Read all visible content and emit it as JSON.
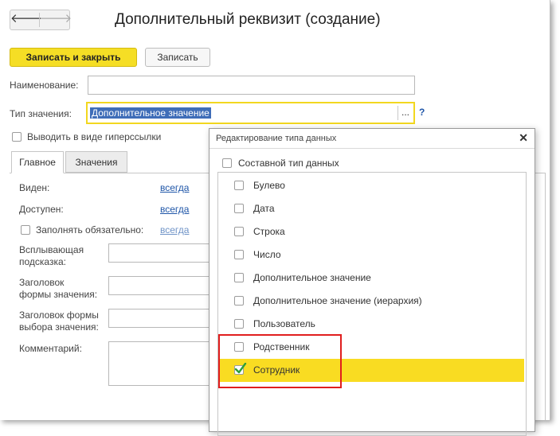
{
  "window": {
    "title": "Дополнительный реквизит (создание)"
  },
  "nav": {
    "back_glyph": "🡐",
    "forward_glyph": "🡒"
  },
  "toolbar": {
    "save_close_label": "Записать и закрыть",
    "save_label": "Записать"
  },
  "form": {
    "name_label": "Наименование:",
    "name_value": "",
    "type_label": "Тип значения:",
    "type_value": "Дополнительное значение",
    "type_button": "...",
    "help": "?",
    "hyperlink_label": "Выводить в виде гиперссылки"
  },
  "tabs": [
    {
      "label": "Главное"
    },
    {
      "label": "Значения"
    }
  ],
  "main": {
    "visible_label": "Виден:",
    "visible_value": "всегда",
    "available_label": "Доступен:",
    "available_value": "всегда",
    "required_label": "Заполнять обязательно:",
    "required_value": "всегда",
    "tooltip_label_1": "Всплывающая",
    "tooltip_label_2": "подсказка:",
    "form_title_label_1": "Заголовок",
    "form_title_label_2": "формы значения:",
    "choice_title_label_1": "Заголовок формы",
    "choice_title_label_2": "выбора значения:",
    "comment_label": "Комментарий:"
  },
  "popup": {
    "title": "Редактирование типа данных",
    "close_glyph": "✕",
    "composite_label": "Составной тип данных",
    "items": [
      {
        "label": "Булево",
        "checked": false
      },
      {
        "label": "Дата",
        "checked": false
      },
      {
        "label": "Строка",
        "checked": false
      },
      {
        "label": "Число",
        "checked": false
      },
      {
        "label": "Дополнительное значение",
        "checked": false
      },
      {
        "label": "Дополнительное значение (иерархия)",
        "checked": false
      },
      {
        "label": "Пользователь",
        "checked": false
      },
      {
        "label": "Родственник",
        "checked": false
      },
      {
        "label": "Сотрудник",
        "checked": true
      }
    ]
  },
  "colors": {
    "accent": "#f5de25",
    "selection": "#f9dc22",
    "highlight_frame": "#e01e1e",
    "link": "#1f56a8",
    "checkmark": "#2e9e3a"
  }
}
